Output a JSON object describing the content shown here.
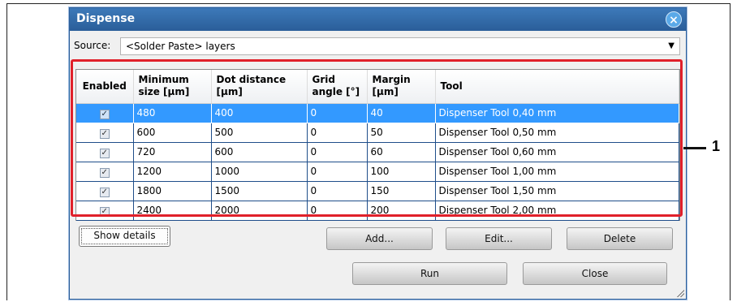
{
  "dialog": {
    "title": "Dispense",
    "close_glyph": "×"
  },
  "source": {
    "label": "Source:",
    "value": "<Solder Paste> layers"
  },
  "table": {
    "headers": [
      "Enabled",
      "Minimum size [µm]",
      "Dot distance [µm]",
      "Grid angle [°]",
      "Margin [µm]",
      "Tool"
    ],
    "rows": [
      {
        "enabled": true,
        "min_size": "480",
        "dot_distance": "400",
        "grid_angle": "0",
        "margin": "40",
        "tool": "Dispenser Tool 0,40 mm",
        "selected": true
      },
      {
        "enabled": true,
        "min_size": "600",
        "dot_distance": "500",
        "grid_angle": "0",
        "margin": "50",
        "tool": "Dispenser Tool 0,50 mm",
        "selected": false
      },
      {
        "enabled": true,
        "min_size": "720",
        "dot_distance": "600",
        "grid_angle": "0",
        "margin": "60",
        "tool": "Dispenser Tool 0,60 mm",
        "selected": false
      },
      {
        "enabled": true,
        "min_size": "1200",
        "dot_distance": "1000",
        "grid_angle": "0",
        "margin": "100",
        "tool": "Dispenser Tool 1,00 mm",
        "selected": false
      },
      {
        "enabled": true,
        "min_size": "1800",
        "dot_distance": "1500",
        "grid_angle": "0",
        "margin": "150",
        "tool": "Dispenser Tool 1,50 mm",
        "selected": false
      },
      {
        "enabled": true,
        "min_size": "2400",
        "dot_distance": "2000",
        "grid_angle": "0",
        "margin": "200",
        "tool": "Dispenser Tool 2,00 mm",
        "selected": false
      }
    ]
  },
  "buttons": {
    "show_details": "Show details",
    "add": "Add...",
    "edit": "Edit...",
    "delete": "Delete",
    "run": "Run",
    "close": "Close"
  },
  "callout": {
    "number": "1",
    "color": "#e0202a"
  },
  "colors": {
    "titlebar": "#2a5e99",
    "selection": "#3399ff"
  },
  "icons": {
    "close": "close-icon",
    "dropdown": "chevron-down-icon",
    "resize": "resize-grip-icon"
  }
}
